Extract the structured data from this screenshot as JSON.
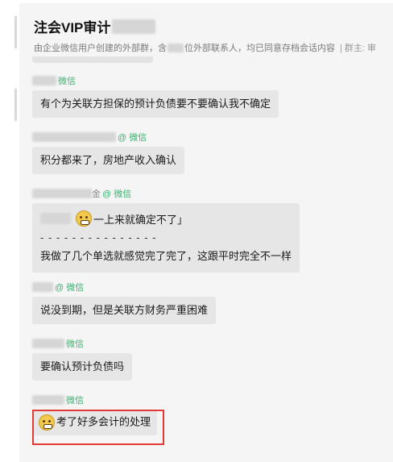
{
  "colors": {
    "window_bg": "#f5f5f5",
    "bubble_bg": "#e6e6e6",
    "wechat_tag": "#3cb371",
    "highlight": "#e53935"
  },
  "header": {
    "group_title": "注会VIP审计",
    "description": "由企业微信用户创建的外部群，含",
    "description_tail": "位外部联系人，均已同意存档会话内容",
    "owner_label": "| 群主: 审"
  },
  "messages": [
    {
      "tag": "微信",
      "text": "有个为关联方担保的预计负债要不要确认我不确定"
    },
    {
      "tag": "@ 微信",
      "text": "积分都来了，房地产收入确认"
    },
    {
      "name_suffix": "金",
      "tag": "@ 微信",
      "quote_text": "一上来就确定不了」",
      "divider": "- - - - - - - - - - - - - - -",
      "text": "我做了几个单选就感觉完了完了，这跟平时完全不一样"
    },
    {
      "tag": "@ 微信",
      "text": "说没到期，但是关联方财务严重困难"
    },
    {
      "tag": "微信",
      "text": "要确认预计负债吗"
    },
    {
      "tag": "微信",
      "text": "考了好多会计的处理",
      "emoji": "grimace-emoji-icon",
      "highlighted": true
    }
  ]
}
